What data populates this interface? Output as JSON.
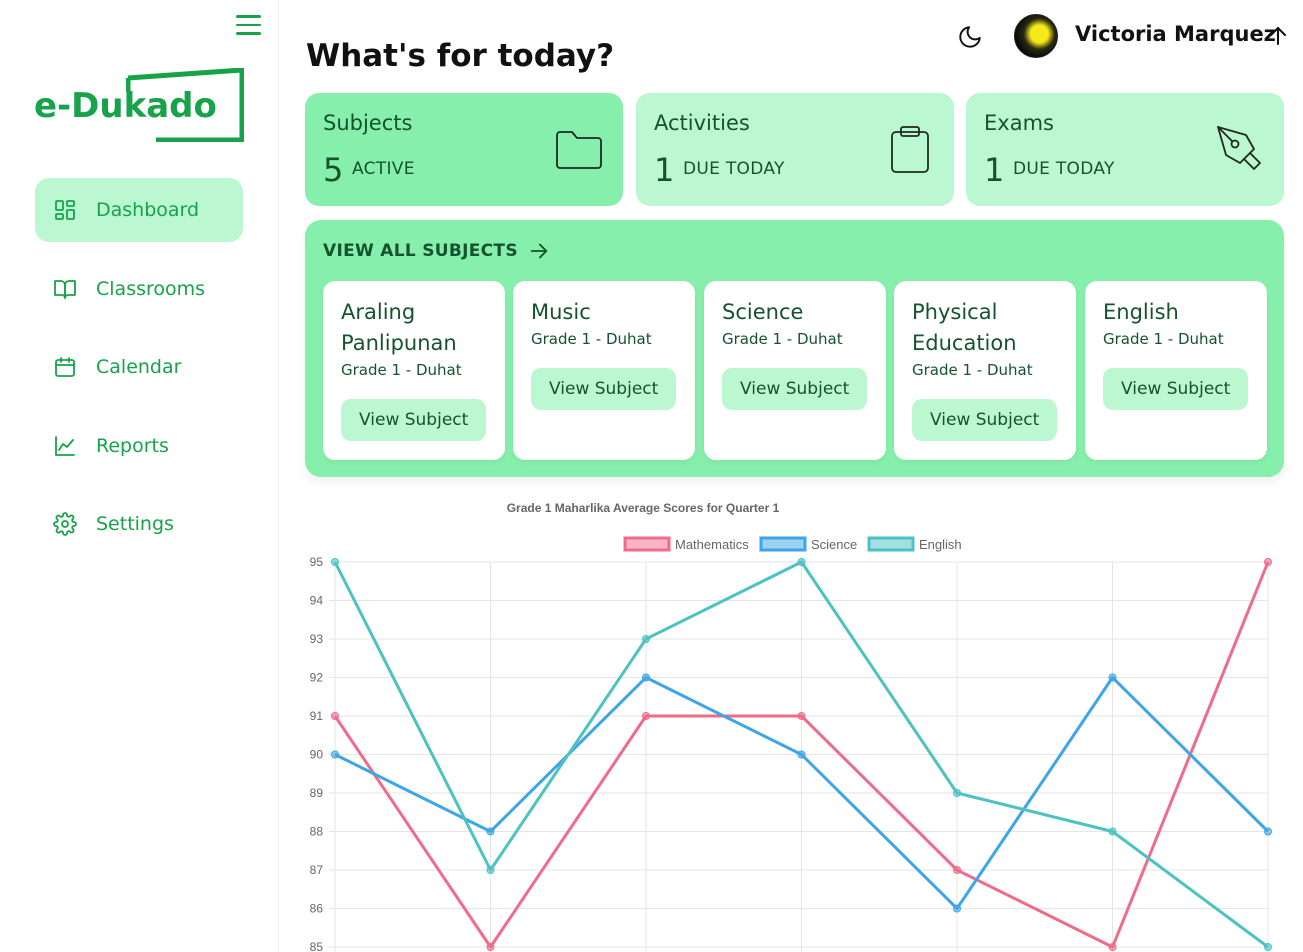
{
  "brand": {
    "name": "e-Dukado",
    "color": "#16a34a"
  },
  "sidebar": {
    "menu_icon": "hamburger-menu-icon",
    "items": [
      {
        "label": "Dashboard",
        "icon": "dashboard-grid-icon",
        "active": true
      },
      {
        "label": "Classrooms",
        "icon": "book-open-icon",
        "active": false
      },
      {
        "label": "Calendar",
        "icon": "calendar-icon",
        "active": false
      },
      {
        "label": "Reports",
        "icon": "chart-line-icon",
        "active": false
      },
      {
        "label": "Settings",
        "icon": "gear-icon",
        "active": false
      }
    ]
  },
  "header": {
    "theme_icon": "moon-icon",
    "user_name": "Victoria Marquez",
    "user_icon": "arrow-up-icon"
  },
  "page_title": "What's for today?",
  "stats": [
    {
      "title": "Subjects",
      "count": "5",
      "label": "ACTIVE",
      "icon": "folder-icon"
    },
    {
      "title": "Activities",
      "count": "1",
      "label": "DUE TODAY",
      "icon": "clipboard-icon"
    },
    {
      "title": "Exams",
      "count": "1",
      "label": "DUE TODAY",
      "icon": "pen-nib-icon"
    }
  ],
  "subjects_panel": {
    "view_all_label": "VIEW ALL SUBJECTS",
    "subjects": [
      {
        "name": "Araling Panlipunan",
        "grade": "Grade 1 - Duhat",
        "button": "View Subject"
      },
      {
        "name": "Music",
        "grade": "Grade 1 - Duhat",
        "button": "View Subject"
      },
      {
        "name": "Science",
        "grade": "Grade 1 - Duhat",
        "button": "View Subject"
      },
      {
        "name": "Physical Education",
        "grade": "Grade 1 - Duhat",
        "button": "View Subject"
      },
      {
        "name": "English",
        "grade": "Grade 1 - Duhat",
        "button": "View Subject"
      }
    ]
  },
  "chart_data": {
    "type": "line",
    "title": "Grade 1 Maharlika Average Scores for Quarter 1",
    "xlabel": "",
    "ylabel": "",
    "ylim": [
      85,
      95
    ],
    "y_ticks": [
      95,
      94,
      93,
      92,
      91,
      90,
      89,
      88,
      87,
      86,
      85
    ],
    "grid": true,
    "legend_position": "top",
    "series": [
      {
        "name": "Mathematics",
        "color": "#f06b8a",
        "values": [
          91,
          85,
          91,
          91,
          87,
          85,
          95
        ]
      },
      {
        "name": "Science",
        "color": "#3ea5e8",
        "values": [
          90,
          88,
          92,
          90,
          86,
          92,
          88
        ]
      },
      {
        "name": "English",
        "color": "#4cc2c2",
        "values": [
          95,
          87,
          93,
          95,
          89,
          88,
          85
        ]
      }
    ]
  }
}
